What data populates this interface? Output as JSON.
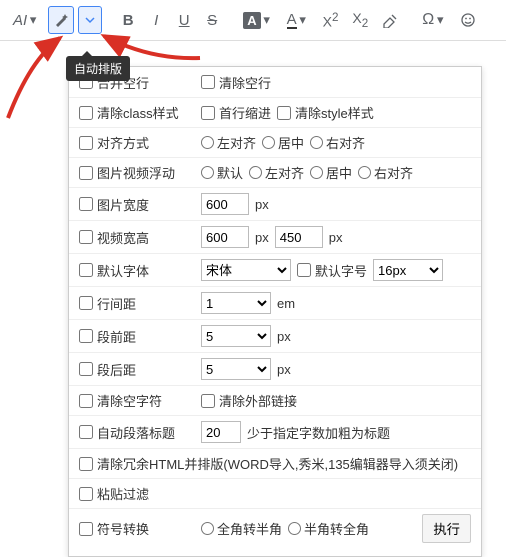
{
  "tooltip": "自动排版",
  "toolbar": {
    "ai": "AI"
  },
  "rows": {
    "mergeEmpty": "合并空行",
    "clearEmpty": "清除空行",
    "clearClass": "清除class样式",
    "firstIndent": "首行缩进",
    "clearStyle": "清除style样式",
    "align": "对齐方式",
    "alignLeft": "左对齐",
    "alignCenter": "居中",
    "alignRight": "右对齐",
    "mediaFloat": "图片视频浮动",
    "floatDefault": "默认",
    "floatLeft": "左对齐",
    "floatCenter": "居中",
    "floatRight": "右对齐",
    "imgWidth": "图片宽度",
    "imgWidthVal": "600",
    "px": "px",
    "videoWH": "视频宽高",
    "videoW": "600",
    "videoH": "450",
    "defFont": "默认字体",
    "defFontVal": "宋体",
    "defSize": "默认字号",
    "defSizeVal": "16px",
    "lineHeight": "行间距",
    "lineHeightVal": "1",
    "em": "em",
    "pBefore": "段前距",
    "pBeforeVal": "5",
    "pAfter": "段后距",
    "pAfterVal": "5",
    "clearNullChar": "清除空字符",
    "clearExtLink": "清除外部链接",
    "autoHeading": "自动段落标题",
    "autoHeadingVal": "20",
    "autoHeadingHint": "少于指定字数加粗为标题",
    "cleanHtml": "清除冗余HTML并排版(WORD导入,秀米,135编辑器导入须关闭)",
    "pasteFilter": "粘贴过滤",
    "symConvert": "符号转换",
    "full2half": "全角转半角",
    "half2full": "半角转全角",
    "exec": "执行"
  }
}
